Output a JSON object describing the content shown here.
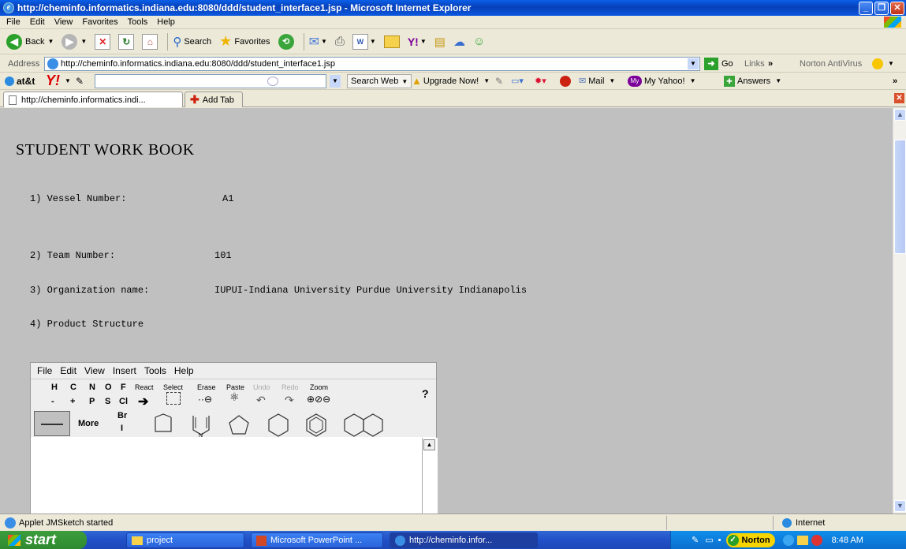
{
  "window": {
    "title": "http://cheminfo.informatics.indiana.edu:8080/ddd/student_interface1.jsp - Microsoft Internet Explorer"
  },
  "menu": [
    "File",
    "Edit",
    "View",
    "Favorites",
    "Tools",
    "Help"
  ],
  "toolbar": {
    "back": "Back",
    "search": "Search",
    "favorites": "Favorites"
  },
  "address": {
    "label": "Address",
    "url": "http://cheminfo.informatics.indiana.edu:8080/ddd/student_interface1.jsp",
    "go": "Go",
    "links": "Links",
    "norton": "Norton AntiVirus"
  },
  "yahoo": {
    "att": "at&t",
    "search_web": "Search Web",
    "upgrade": "Upgrade Now!",
    "mail": "Mail",
    "my_yahoo": "My Yahoo!",
    "answers": "Answers"
  },
  "tabs": {
    "current": "http://cheminfo.informatics.indi...",
    "add": "Add Tab"
  },
  "page": {
    "heading": "STUDENT WORK BOOK",
    "q1_label": "1) Vessel Number:",
    "q1_value": "A1",
    "q2_label": "2) Team Number:",
    "q2_value": "101",
    "q3_label": "3) Organization name:",
    "q3_value": "IUPUI-Indiana University Purdue University Indianapolis",
    "q4_label": "4) Product Structure"
  },
  "applet": {
    "menu": [
      "File",
      "Edit",
      "View",
      "Insert",
      "Tools",
      "Help"
    ],
    "elements_row1": [
      "H",
      "C",
      "N",
      "O",
      "F"
    ],
    "elements_row2": [
      "-",
      "+",
      "P",
      "S",
      "Cl"
    ],
    "br": "Br",
    "i": "I",
    "tool_labels": [
      "React",
      "Select",
      "Erase",
      "Paste",
      "Undo",
      "Redo",
      "Zoom"
    ],
    "help": "?",
    "more": "More"
  },
  "status": {
    "text": "Applet JMSketch started",
    "zone": "Internet"
  },
  "taskbar": {
    "start": "start",
    "items": [
      "project",
      "Microsoft PowerPoint ...",
      "http://cheminfo.infor..."
    ],
    "norton": "Norton",
    "time": "8:48 AM"
  }
}
